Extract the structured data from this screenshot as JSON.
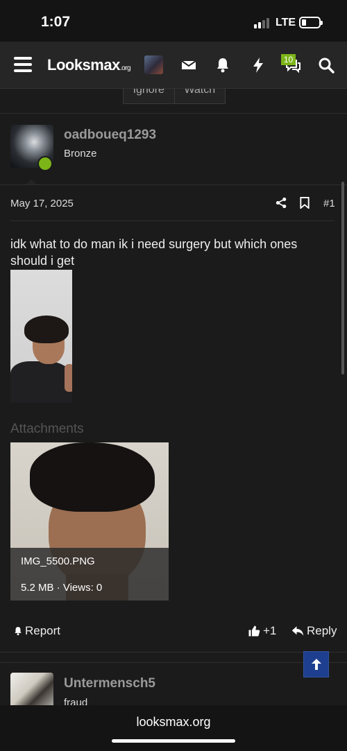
{
  "status_bar": {
    "time": "1:07",
    "network": "LTE"
  },
  "header": {
    "logo_main": "Looksmax",
    "logo_suffix": ".org",
    "conversations_badge": "10"
  },
  "thread_actions": {
    "ignore_label": "Ignore",
    "watch_label": "Watch"
  },
  "post1": {
    "username": "oadboueq1293",
    "user_title": "Bronze",
    "date": "May 17, 2025",
    "number": "#1",
    "text": "idk what to do man ik i need surgery but which ones should i get",
    "attachments_label": "Attachments",
    "attachment": {
      "filename": "IMG_5500.PNG",
      "meta": "5.2 MB · Views: 0"
    },
    "report_label": "Report",
    "like_label": "+1",
    "reply_label": "Reply"
  },
  "post2": {
    "username": "Untermensch5",
    "user_title": "fraud"
  },
  "browser": {
    "url": "looksmax.org"
  },
  "colors": {
    "accent_green": "#7cb518",
    "scroll_top_blue": "#1e3f8f"
  },
  "icons": [
    "hamburger-icon",
    "envelope-icon",
    "bell-icon",
    "bolt-icon",
    "chat-icon",
    "search-icon",
    "share-icon",
    "bookmark-icon",
    "thumbs-up-icon",
    "reply-icon",
    "arrow-up-icon"
  ]
}
